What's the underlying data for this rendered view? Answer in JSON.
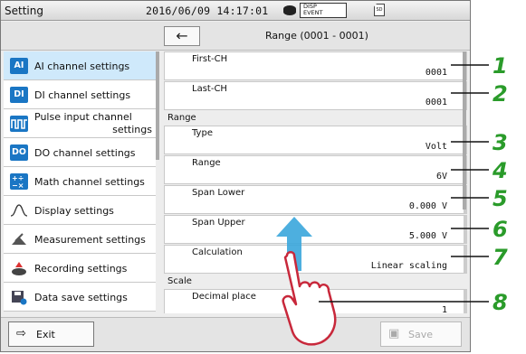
{
  "statusbar": {
    "title": "Setting",
    "datetime": "2016/06/09 14:17:01",
    "flag_disp": "DISP",
    "flag_event": "EVENT",
    "sd": "SD"
  },
  "navbar": {
    "back_icon": "arrow-left-icon",
    "title": "Range (0001 - 0001)"
  },
  "sidebar": {
    "items": [
      {
        "icon": "AI",
        "label": "AI channel settings",
        "active": true
      },
      {
        "icon": "DI",
        "label": "DI channel settings"
      },
      {
        "icon": "pulse-icon",
        "label_line1": "Pulse input channel",
        "label_line2": "settings"
      },
      {
        "icon": "DO",
        "label": "DO channel settings"
      },
      {
        "icon": "math-icon",
        "label": "Math channel settings"
      },
      {
        "icon": "display-icon",
        "label": "Display settings"
      },
      {
        "icon": "measurement-icon",
        "label": "Measurement settings"
      },
      {
        "icon": "recording-icon",
        "label": "Recording settings"
      },
      {
        "icon": "data-save-icon",
        "label": "Data save settings"
      }
    ]
  },
  "content": {
    "first_ch": {
      "label": "First-CH",
      "value": "0001"
    },
    "last_ch": {
      "label": "Last-CH",
      "value": "0001"
    },
    "range_section": "Range",
    "type": {
      "label": "Type",
      "value": "Volt"
    },
    "range": {
      "label": "Range",
      "value": "6V"
    },
    "span_lower": {
      "label": "Span Lower",
      "value": "0.000 V"
    },
    "span_upper": {
      "label": "Span Upper",
      "value": "5.000 V"
    },
    "calculation": {
      "label": "Calculation",
      "value": "Linear scaling"
    },
    "scale_section": "Scale",
    "decimal_place": {
      "label": "Decimal place",
      "value": "1"
    }
  },
  "bottombar": {
    "exit_label": "Exit",
    "save_label": "Save"
  },
  "callouts": [
    "1",
    "2",
    "3",
    "4",
    "5",
    "6",
    "7",
    "8"
  ],
  "colors": {
    "accent_blue": "#1a76c4",
    "callout_green": "#2a9b2a",
    "active_item": "#cfe9fb",
    "swipe_arrow": "#3aa6dc"
  }
}
